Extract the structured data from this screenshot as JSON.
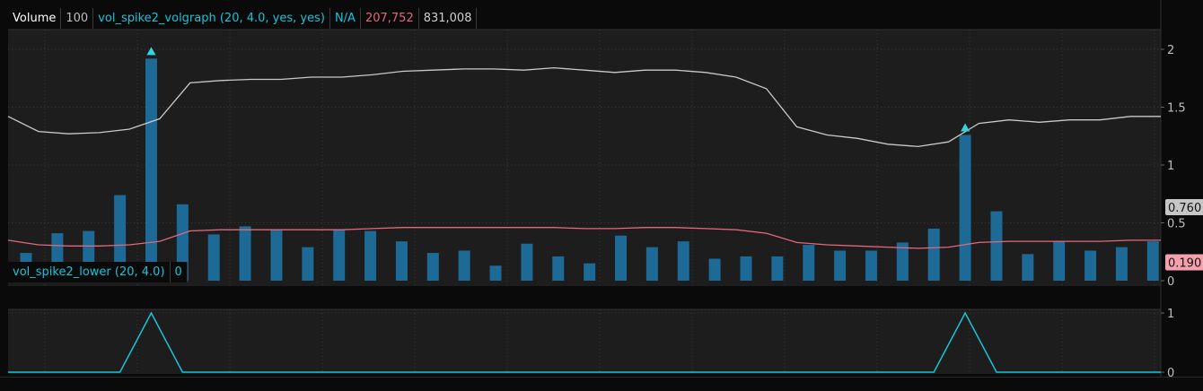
{
  "colors": {
    "bar": "#1c6a95",
    "avg_line": "#e3677d",
    "upper_line": "#c9c9c9",
    "arrow": "#2fd6e0",
    "lower_line": "#19c4d6",
    "grid": "#3a3a3a",
    "header_text": "#ffffff",
    "header_cyan": "#19c4d6",
    "header_pink": "#e3677d",
    "header_gray": "#cfcfcf"
  },
  "upper_header": {
    "label": "Volume",
    "period": "100",
    "study": "vol_spike2_volgraph (20, 4.0, yes, yes)",
    "na": "N/A",
    "value_pink": "207,752",
    "value_gray": "831,008"
  },
  "lower_header": {
    "study": "vol_spike2_lower (20, 4.0)",
    "value": "0"
  },
  "price_badges": {
    "upper": "0.760",
    "avg": "0.190"
  },
  "chart_data": [
    {
      "type": "bar",
      "name": "volume",
      "ylim": [
        0,
        2.2
      ],
      "yticks": [
        "2",
        "1.5",
        "1",
        "0.5",
        "0"
      ],
      "ytick_values": [
        2,
        1.5,
        1,
        0.5,
        0
      ],
      "x": [
        0,
        1,
        2,
        3,
        4,
        5,
        6,
        7,
        8,
        9,
        10,
        11,
        12,
        13,
        14,
        15,
        16,
        17,
        18,
        19,
        20,
        21,
        22,
        23,
        24,
        25,
        26,
        27,
        28,
        29,
        30,
        31,
        32,
        33,
        34,
        35,
        36
      ],
      "values": [
        0.24,
        0.41,
        0.43,
        0.74,
        1.92,
        0.66,
        0.4,
        0.47,
        0.44,
        0.29,
        0.44,
        0.43,
        0.34,
        0.24,
        0.26,
        0.13,
        0.32,
        0.21,
        0.15,
        0.39,
        0.29,
        0.34,
        0.19,
        0.21,
        0.21,
        0.31,
        0.26,
        0.26,
        0.33,
        0.45,
        1.26,
        0.6,
        0.23,
        0.34,
        0.26,
        0.29,
        0.34
      ],
      "upper_line": [
        1.42,
        1.29,
        1.27,
        1.28,
        1.31,
        1.4,
        1.71,
        1.73,
        1.74,
        1.74,
        1.76,
        1.76,
        1.78,
        1.81,
        1.82,
        1.83,
        1.83,
        1.82,
        1.84,
        1.82,
        1.8,
        1.82,
        1.82,
        1.8,
        1.76,
        1.66,
        1.33,
        1.26,
        1.23,
        1.18,
        1.16,
        1.2,
        1.36,
        1.39,
        1.37,
        1.39,
        1.39,
        1.42,
        1.42
      ],
      "avg_line": [
        0.35,
        0.31,
        0.3,
        0.3,
        0.31,
        0.34,
        0.43,
        0.44,
        0.44,
        0.44,
        0.44,
        0.44,
        0.45,
        0.46,
        0.46,
        0.46,
        0.46,
        0.46,
        0.46,
        0.45,
        0.45,
        0.46,
        0.46,
        0.45,
        0.44,
        0.41,
        0.33,
        0.31,
        0.3,
        0.29,
        0.28,
        0.29,
        0.33,
        0.34,
        0.34,
        0.34,
        0.34,
        0.35,
        0.35
      ],
      "spikes": [
        4,
        30
      ]
    },
    {
      "type": "line",
      "name": "vol_spike2_lower",
      "ylim": [
        0,
        1
      ],
      "yticks": [
        "1",
        "0"
      ],
      "ytick_values": [
        1,
        0
      ],
      "x": [
        0,
        1,
        2,
        3,
        4,
        5,
        6,
        7,
        8,
        9,
        10,
        11,
        12,
        13,
        14,
        15,
        16,
        17,
        18,
        19,
        20,
        21,
        22,
        23,
        24,
        25,
        26,
        27,
        28,
        29,
        30,
        31,
        32,
        33,
        34,
        35,
        36
      ],
      "values": [
        0,
        0,
        0,
        0,
        1,
        0,
        0,
        0,
        0,
        0,
        0,
        0,
        0,
        0,
        0,
        0,
        0,
        0,
        0,
        0,
        0,
        0,
        0,
        0,
        0,
        0,
        0,
        0,
        0,
        0,
        1,
        0,
        0,
        0,
        0,
        0,
        0
      ]
    }
  ]
}
